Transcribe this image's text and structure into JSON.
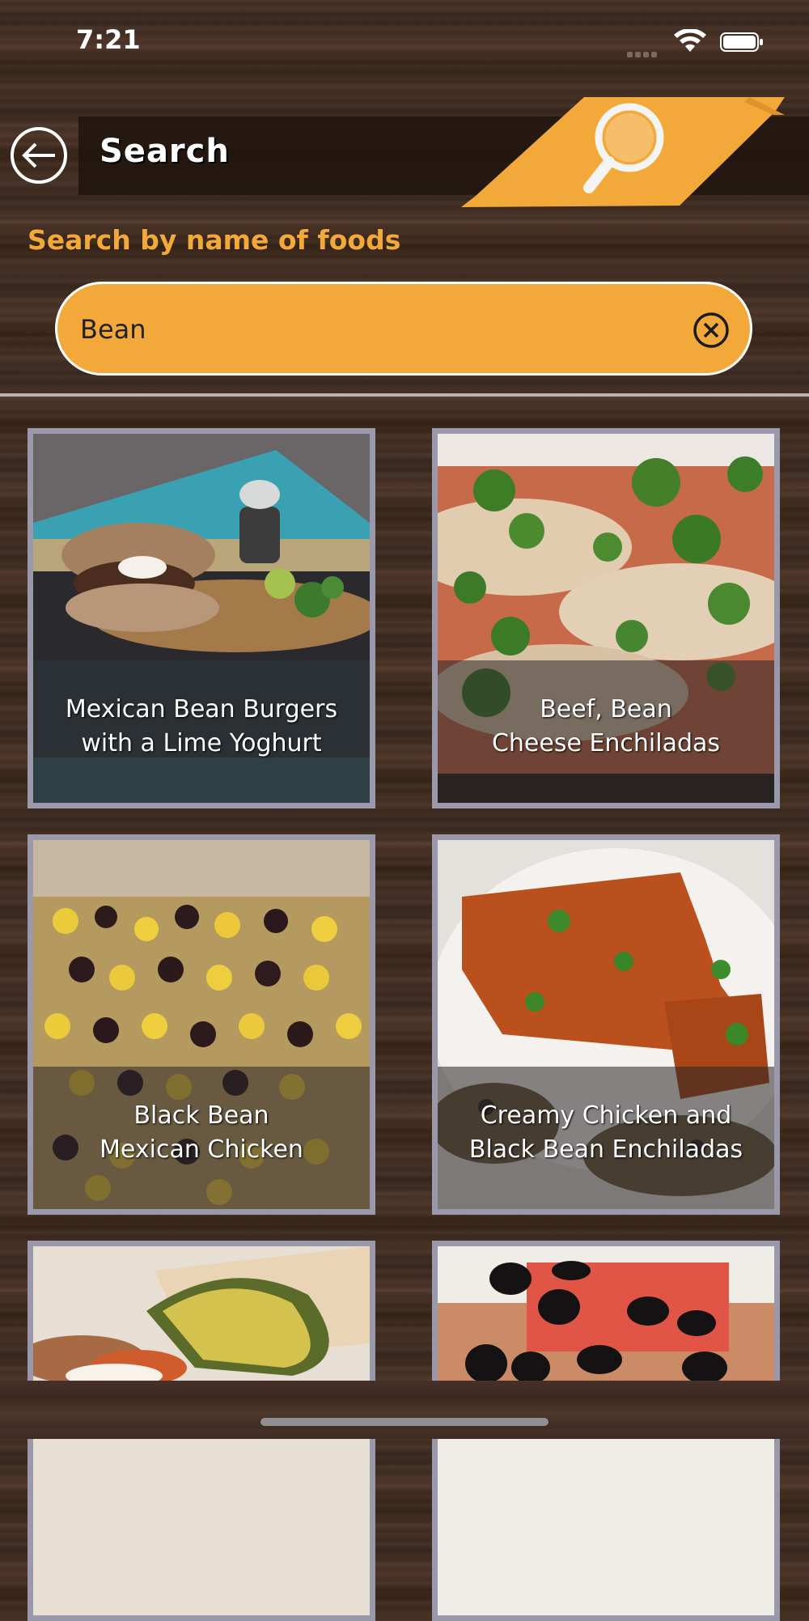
{
  "status_bar": {
    "time": "7:21"
  },
  "header": {
    "title": "Search",
    "back_icon": "back-arrow-icon",
    "banner_icon": "magnifier-icon",
    "accent_color": "#f3a93a"
  },
  "search": {
    "hint": "Search by name of foods",
    "value": "Bean",
    "clear_icon": "clear-circle-icon"
  },
  "results": [
    {
      "line1": "Mexican Bean Burgers",
      "line2": "with a Lime Yoghurt"
    },
    {
      "line1": "Beef, Bean",
      "line2": "Cheese Enchiladas"
    },
    {
      "line1": "Black Bean",
      "line2": "Mexican Chicken"
    },
    {
      "line1": "Creamy Chicken and",
      "line2": "Black Bean Enchiladas"
    },
    {
      "line1": "",
      "line2": ""
    },
    {
      "line1": "",
      "line2": ""
    }
  ]
}
